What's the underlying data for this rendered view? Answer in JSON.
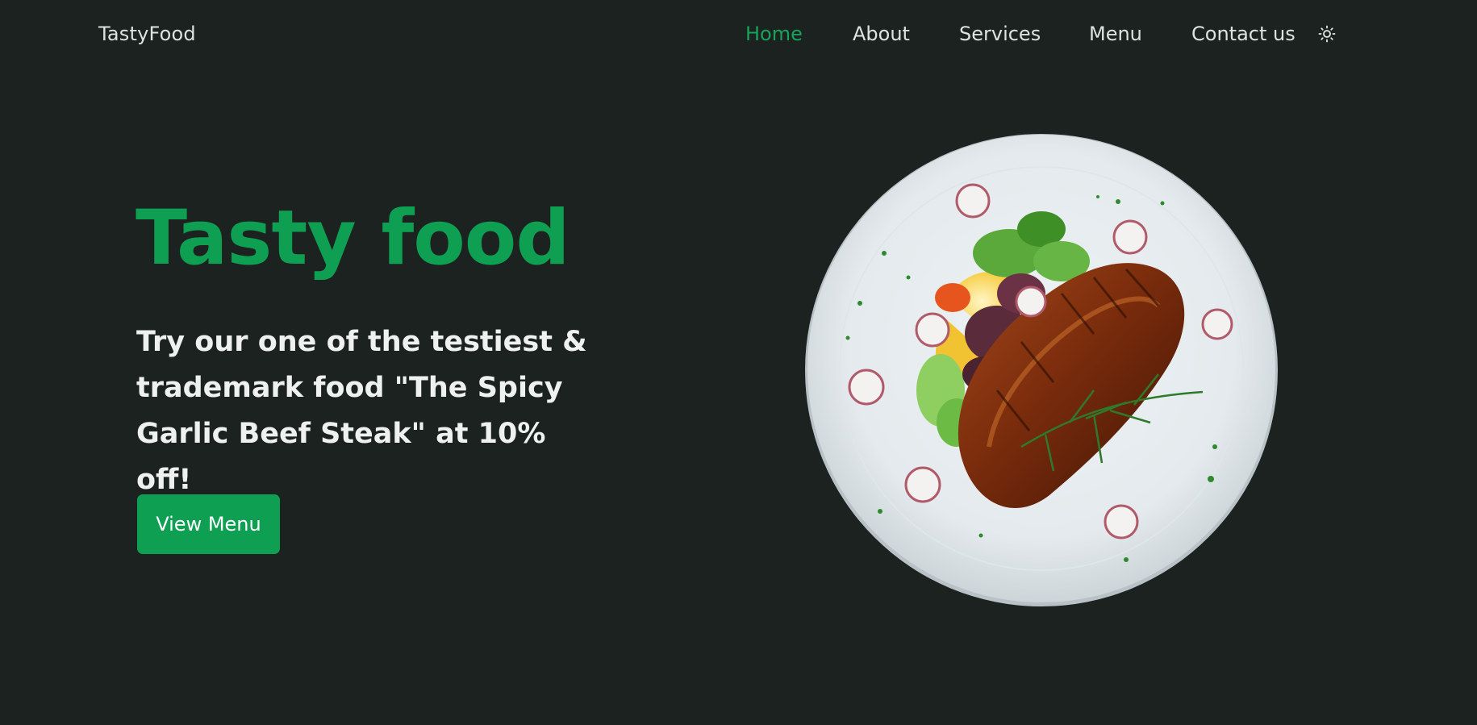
{
  "header": {
    "logo": "TastyFood",
    "nav": [
      {
        "label": "Home",
        "active": true
      },
      {
        "label": "About",
        "active": false
      },
      {
        "label": "Services",
        "active": false
      },
      {
        "label": "Menu",
        "active": false
      },
      {
        "label": "Contact us",
        "active": false
      }
    ],
    "theme_toggle_icon": "sun-icon"
  },
  "hero": {
    "title": "Tasty food",
    "subtitle": "Try our one of the testiest & trademark food \"The Spicy Garlic Beef Steak\" at 10% off!",
    "cta_label": "View Menu",
    "image_icon": "plate-steak-image"
  },
  "colors": {
    "background": "#1c221f",
    "accent": "#0e9f52",
    "nav_text": "#dfe3e0",
    "heading_text": "#eef1ef"
  }
}
